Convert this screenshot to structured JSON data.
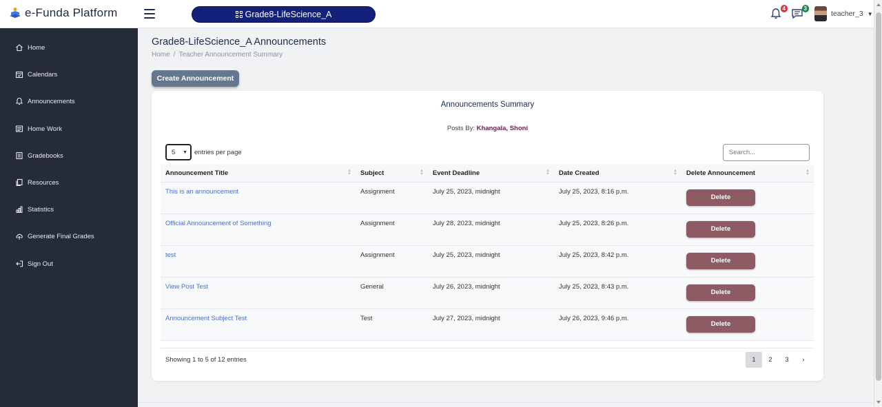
{
  "brand": {
    "name": "e-Funda Platform"
  },
  "class_pill": {
    "label": "Grade8-LifeScience_A"
  },
  "header": {
    "notifications_count": "4",
    "messages_count": "3",
    "username": "teacher_3"
  },
  "colors": {
    "notification_badge": "#dc3545",
    "message_badge": "#198754",
    "pill_bg": "#13217a",
    "sidebar_bg": "#252b38",
    "delete_btn": "#8e5a64"
  },
  "sidebar": {
    "items": [
      {
        "label": "Home",
        "icon": "home-icon"
      },
      {
        "label": "Calendars",
        "icon": "calendar-icon"
      },
      {
        "label": "Announcements",
        "icon": "bell-icon"
      },
      {
        "label": "Home Work",
        "icon": "list-icon"
      },
      {
        "label": "Gradebooks",
        "icon": "book-icon"
      },
      {
        "label": "Resources",
        "icon": "copy-icon"
      },
      {
        "label": "Statistics",
        "icon": "bar-chart-icon"
      },
      {
        "label": "Generate Final Grades",
        "icon": "cloud-upload-icon"
      },
      {
        "label": "Sign Out",
        "icon": "sign-out-icon"
      }
    ]
  },
  "page": {
    "title": "Grade8-LifeScience_A Announcements",
    "breadcrumb": [
      "Home",
      "/",
      "Teacher Announcement Summary"
    ],
    "create_button": "Create Announcement"
  },
  "card": {
    "title": "Announcements Summary",
    "posts_by_label": "Posts By:",
    "posts_by_name": "Khangala, Shoni",
    "entries_value": "5",
    "entries_label": "entries per page",
    "search_placeholder": "Search...",
    "columns": [
      "Announcement Title",
      "Subject",
      "Event Deadline",
      "Date Created",
      "Delete Announcement"
    ],
    "rows": [
      {
        "title": "This is an announcement",
        "subject": "Assignment",
        "deadline": "July 25, 2023, midnight",
        "created": "July 25, 2023, 8:16 p.m.",
        "action": "Delete"
      },
      {
        "title": "Official Announcement of Something",
        "subject": "Assignment",
        "deadline": "July 28, 2023, midnight",
        "created": "July 25, 2023, 8:26 p.m.",
        "action": "Delete"
      },
      {
        "title": "test",
        "subject": "Assignment",
        "deadline": "July 25, 2023, midnight",
        "created": "July 25, 2023, 8:42 p.m.",
        "action": "Delete"
      },
      {
        "title": "View Post Test",
        "subject": "General",
        "deadline": "July 26, 2023, midnight",
        "created": "July 25, 2023, 8:43 p.m.",
        "action": "Delete"
      },
      {
        "title": "Announcement Subject Test",
        "subject": "Test",
        "deadline": "July 27, 2023, midnight",
        "created": "July 26, 2023, 9:46 p.m.",
        "action": "Delete"
      }
    ],
    "showing": "Showing 1 to 5 of 12 entries",
    "pages": [
      "1",
      "2",
      "3",
      "›"
    ],
    "current_page": "1"
  }
}
